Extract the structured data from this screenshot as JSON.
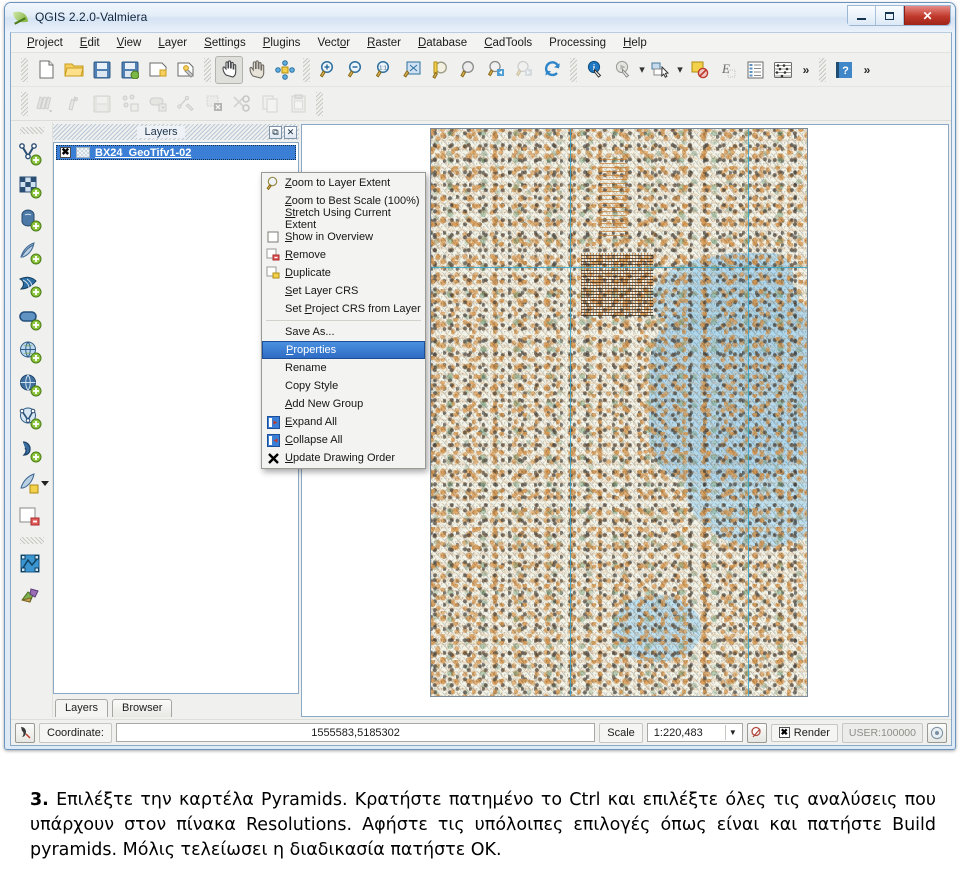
{
  "window": {
    "title": "QGIS 2.2.0-Valmiera",
    "controls": {
      "minimize": "minimize",
      "maximize": "maximize",
      "close": "✕"
    }
  },
  "menubar": {
    "items": [
      {
        "label": "Project"
      },
      {
        "label": "Edit"
      },
      {
        "label": "View"
      },
      {
        "label": "Layer"
      },
      {
        "label": "Settings"
      },
      {
        "label": "Plugins"
      },
      {
        "label": "Vector"
      },
      {
        "label": "Raster"
      },
      {
        "label": "Database"
      },
      {
        "label": "CadTools"
      },
      {
        "label": "Processing"
      },
      {
        "label": "Help"
      }
    ]
  },
  "toolbar_main": {
    "buttons": [
      {
        "name": "new-project-icon",
        "tip": "New Project"
      },
      {
        "name": "open-project-icon",
        "tip": "Open Project"
      },
      {
        "name": "save-project-icon",
        "tip": "Save Project"
      },
      {
        "name": "save-project-as-icon",
        "tip": "Save Project As"
      },
      {
        "name": "new-print-composer-icon",
        "tip": "New Print Composer"
      },
      {
        "name": "composer-manager-icon",
        "tip": "Composer Manager"
      },
      {
        "name": "pan-map-icon",
        "tip": "Pan Map",
        "active": true
      },
      {
        "name": "pan-to-selection-icon",
        "tip": "Pan Map to Selection"
      },
      {
        "name": "touch-zoom-icon",
        "tip": "Touch Zoom and Pan"
      },
      {
        "name": "zoom-in-icon",
        "tip": "Zoom In"
      },
      {
        "name": "zoom-out-icon",
        "tip": "Zoom Out"
      },
      {
        "name": "zoom-native-icon",
        "tip": "Zoom to Native Resolution (100%)"
      },
      {
        "name": "zoom-full-icon",
        "tip": "Zoom Full"
      },
      {
        "name": "zoom-to-selection-icon",
        "tip": "Zoom to Selection"
      },
      {
        "name": "zoom-to-layer-icon",
        "tip": "Zoom to Layer"
      },
      {
        "name": "zoom-last-icon",
        "tip": "Zoom Last"
      },
      {
        "name": "zoom-next-icon",
        "tip": "Zoom Next",
        "disabled": true
      },
      {
        "name": "refresh-icon",
        "tip": "Refresh"
      },
      {
        "name": "identify-features-icon",
        "tip": "Identify Features"
      },
      {
        "name": "run-feature-action-icon",
        "tip": "Run Feature Action"
      },
      {
        "name": "select-features-icon",
        "tip": "Select Features"
      },
      {
        "name": "deselect-features-icon",
        "tip": "Deselect Features"
      },
      {
        "name": "measure-icon",
        "tip": "Measure"
      },
      {
        "name": "open-attribute-table-icon",
        "tip": "Open Attribute Table"
      },
      {
        "name": "statistics-icon",
        "tip": "Statistical Summary"
      },
      {
        "name": "toolbar-overflow-icon",
        "tip": "More",
        "glyph": "»"
      },
      {
        "name": "help-icon",
        "tip": "Help"
      },
      {
        "name": "toolbar-overflow-2-icon",
        "tip": "More",
        "glyph": "»"
      }
    ]
  },
  "toolbar_digitizing": {
    "buttons": [
      {
        "name": "current-edits-icon",
        "tip": "Current Edits"
      },
      {
        "name": "toggle-editing-icon",
        "tip": "Toggle Editing"
      },
      {
        "name": "save-layer-edits-icon",
        "tip": "Save Layer Edits"
      },
      {
        "name": "add-feature-icon",
        "tip": "Add Feature"
      },
      {
        "name": "move-feature-icon",
        "tip": "Move Feature"
      },
      {
        "name": "node-tool-icon",
        "tip": "Node Tool"
      },
      {
        "name": "delete-selected-icon",
        "tip": "Delete Selected"
      },
      {
        "name": "cut-features-icon",
        "tip": "Cut Features"
      },
      {
        "name": "copy-features-icon",
        "tip": "Copy Features"
      },
      {
        "name": "paste-features-icon",
        "tip": "Paste Features"
      }
    ]
  },
  "toolbar_layers": {
    "buttons": [
      {
        "name": "add-vector-layer-icon",
        "tip": "Add Vector Layer"
      },
      {
        "name": "add-raster-layer-icon",
        "tip": "Add Raster Layer"
      },
      {
        "name": "add-postgis-layer-icon",
        "tip": "Add PostGIS Layer"
      },
      {
        "name": "add-spatialite-layer-icon",
        "tip": "Add SpatiaLite Layer"
      },
      {
        "name": "add-mssql-layer-icon",
        "tip": "Add MSSQL Spatial Layer"
      },
      {
        "name": "add-oracle-layer-icon",
        "tip": "Add Oracle Spatial Layer"
      },
      {
        "name": "add-wms-layer-icon",
        "tip": "Add WMS/WMTS Layer"
      },
      {
        "name": "add-wcs-layer-icon",
        "tip": "Add WCS Layer"
      },
      {
        "name": "add-wfs-layer-icon",
        "tip": "Add WFS Layer"
      },
      {
        "name": "add-delimited-text-layer-icon",
        "tip": "Add Delimited Text Layer"
      },
      {
        "name": "new-shapefile-layer-icon",
        "tip": "New Shapefile Layer"
      },
      {
        "name": "remove-layer-icon",
        "tip": "Remove Layer"
      },
      {
        "name": "open-layer-styling-icon",
        "tip": "Layer Styling"
      },
      {
        "name": "plugins-manager-icon",
        "tip": "Plugins Manager"
      }
    ]
  },
  "layers_panel": {
    "title": "Layers",
    "float_button": "⧉",
    "close_button": "✕",
    "layers": [
      {
        "name": "BX24_GeoTifv1-02",
        "checked": "✖",
        "visible": true
      }
    ],
    "tabs": [
      {
        "label": "Layers",
        "selected": true
      },
      {
        "label": "Browser",
        "selected": false
      }
    ]
  },
  "context_menu": {
    "items": [
      {
        "label": "Zoom to Layer Extent",
        "icon": "zoom-layer-icon",
        "selected": false
      },
      {
        "label": "Zoom to Best Scale (100%)",
        "icon": "",
        "selected": false
      },
      {
        "label": "Stretch Using Current Extent",
        "icon": "",
        "selected": false
      },
      {
        "label": "Show in Overview",
        "icon": "checkbox-icon",
        "selected": false
      },
      {
        "label": "Remove",
        "icon": "remove-layer-icon",
        "selected": false
      },
      {
        "label": "Duplicate",
        "icon": "duplicate-layer-icon",
        "selected": false
      },
      {
        "label": "Set Layer CRS",
        "icon": "",
        "selected": false
      },
      {
        "label": "Set Project CRS from Layer",
        "icon": "",
        "selected": false,
        "separator_after": true
      },
      {
        "label": "Save As...",
        "icon": "",
        "selected": false
      },
      {
        "label": "Properties",
        "icon": "",
        "selected": true
      },
      {
        "label": "Rename",
        "icon": "",
        "selected": false
      },
      {
        "label": "Copy Style",
        "icon": "",
        "selected": false
      },
      {
        "label": "Add New Group",
        "icon": "",
        "selected": false
      },
      {
        "label": "Expand All",
        "icon": "expand-all-icon",
        "selected": false
      },
      {
        "label": "Collapse All",
        "icon": "collapse-all-icon",
        "selected": false
      },
      {
        "label": "Update Drawing Order",
        "icon": "update-order-icon",
        "selected": false
      }
    ]
  },
  "status_bar": {
    "coordinate_label": "Coordinate:",
    "coordinate_value": "1555583,5185302",
    "scale_label": "Scale",
    "scale_value": "1:220,483",
    "render_label": "Render",
    "render_checked": "✖",
    "crs_label": "USER:100000"
  },
  "caption": {
    "number": "3.",
    "text": "Επιλέξτε την καρτέλα Pyramids. Κρατήστε πατημένο το Ctrl και επιλέξτε όλες τις αναλύσεις που υπάρχουν στον πίνακα Resolutions. Αφήστε τις υπόλοιπες επιλογές όπως είναι και πατήστε Build pyramids. Μόλις τελείωσει η διαδικασία πατήστε OK."
  },
  "colors": {
    "selection_blue": "#2f6dc4",
    "title_bar": "#e3edf8",
    "close_red": "#c0392b",
    "map_water": "#bfe0ef",
    "map_land": "#f3f3e8",
    "grid_line": "#3aa5c9",
    "panel_bg": "#f0f0ee"
  }
}
